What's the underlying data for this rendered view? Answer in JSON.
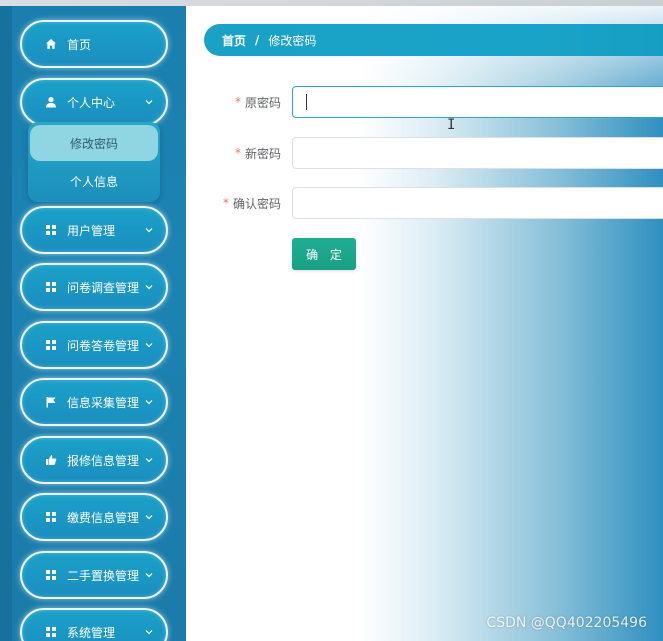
{
  "sidebar": {
    "items": [
      {
        "label": "首页",
        "icon": "home-icon"
      },
      {
        "label": "个人中心",
        "icon": "user-icon",
        "expanded": true,
        "children": [
          {
            "label": "修改密码",
            "active": true
          },
          {
            "label": "个人信息"
          }
        ]
      },
      {
        "label": "用户管理",
        "icon": "grid-icon"
      },
      {
        "label": "问卷调查管理",
        "icon": "grid-icon"
      },
      {
        "label": "问卷答卷管理",
        "icon": "grid-icon"
      },
      {
        "label": "信息采集管理",
        "icon": "flag-icon"
      },
      {
        "label": "报修信息管理",
        "icon": "thumb-icon"
      },
      {
        "label": "缴费信息管理",
        "icon": "grid-icon"
      },
      {
        "label": "二手置换管理",
        "icon": "grid-icon"
      },
      {
        "label": "系统管理",
        "icon": "grid-icon"
      }
    ]
  },
  "breadcrumb": {
    "home": "首页",
    "separator": "/",
    "current": "修改密码"
  },
  "form": {
    "required_mark": "*",
    "old_password": {
      "label": "原密码",
      "value": ""
    },
    "new_password": {
      "label": "新密码",
      "value": ""
    },
    "confirm_password": {
      "label": "确认密码",
      "value": ""
    },
    "submit_label": "确 定"
  },
  "watermark": "CSDN @QQ402205496",
  "colors": {
    "sidebar_bg": "#1b80af",
    "menu_pill": "#1a9cc6",
    "breadcrumb_bg": "#1aa1c6",
    "submit_bg": "#1ba68c",
    "required": "#f56c6c"
  }
}
